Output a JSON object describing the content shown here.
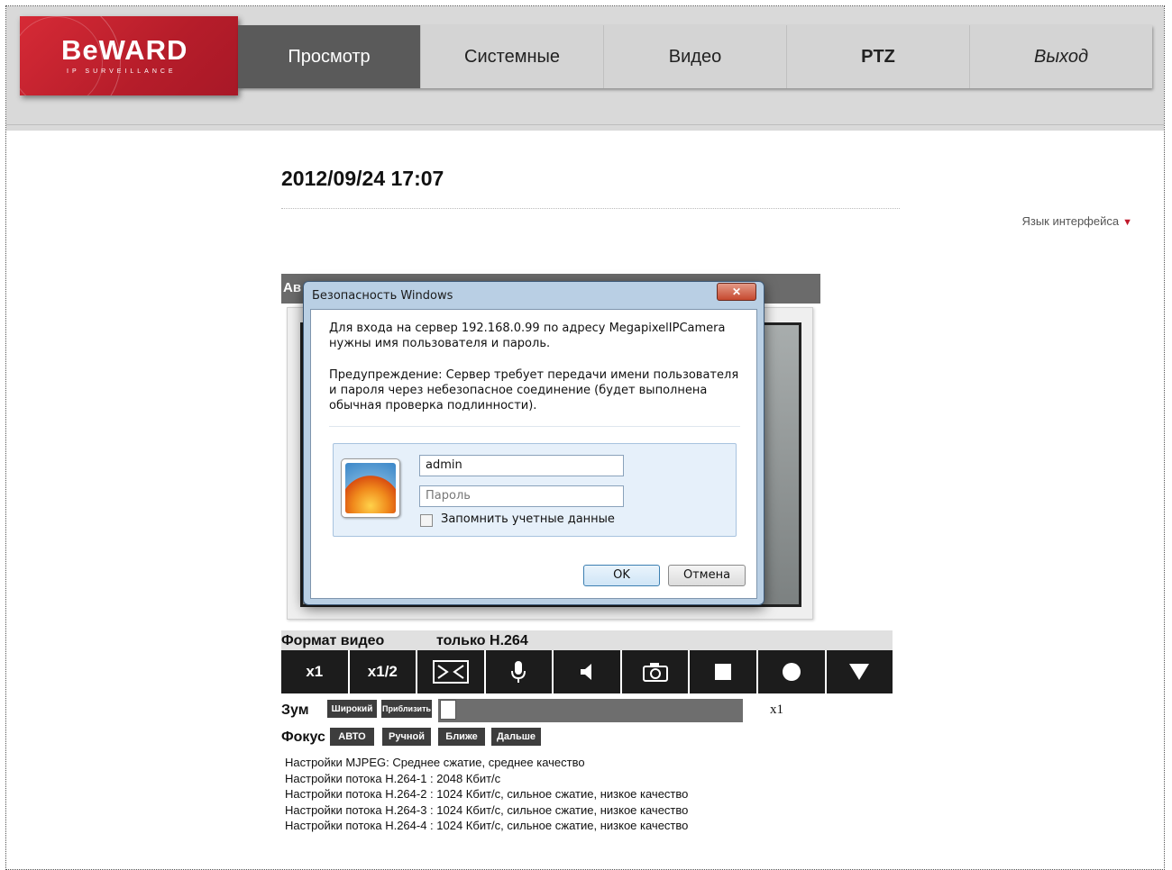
{
  "logo": {
    "brand": "BeWARD",
    "tagline": "IP SURVEILLANCE"
  },
  "nav": {
    "items": [
      {
        "label": "Просмотр"
      },
      {
        "label": "Системные"
      },
      {
        "label": "Видео"
      },
      {
        "label": "PTZ"
      },
      {
        "label": "Выход"
      }
    ]
  },
  "datetime": "2012/09/24 17:07",
  "language_label": "Язык интерфейса",
  "video": {
    "header_text": "Ав"
  },
  "dialog": {
    "title": "Безопасность Windows",
    "message": "Для входа на сервер 192.168.0.99  по адресу MegapixelIPCamera нужны имя пользователя и пароль.",
    "warning": "Предупреждение: Сервер требует передачи имени пользователя и пароля через небезопасное соединение (будет выполнена обычная проверка подлинности).",
    "username_value": "admin",
    "password_placeholder": "Пароль",
    "remember_label": "Запомнить учетные данные",
    "ok_label": "OK",
    "cancel_label": "Отмена"
  },
  "format": {
    "label": "Формат видео",
    "value": "только H.264"
  },
  "controls": {
    "zoom1_label": "x1",
    "zoom_half_label": "x1/2"
  },
  "zoom": {
    "label": "Зум",
    "wide_label": "Широкий",
    "tele_label": "Приблизить",
    "value": "x1",
    "level": 0
  },
  "focus": {
    "label": "Фокус",
    "auto_label": "АВТО",
    "manual_label": "Ручной",
    "near_label": "Ближе",
    "far_label": "Дальше"
  },
  "stream_info": [
    "Настройки MJPEG: Среднее сжатие, среднее качество",
    "Настройки потока H.264-1 : 2048 Кбит/с",
    "Настройки потока H.264-2 : 1024 Кбит/с, сильное сжатие, низкое качество",
    "Настройки потока H.264-3 : 1024 Кбит/с, сильное сжатие, низкое качество",
    "Настройки потока H.264-4 : 1024 Кбит/с, сильное сжатие, низкое качество"
  ]
}
